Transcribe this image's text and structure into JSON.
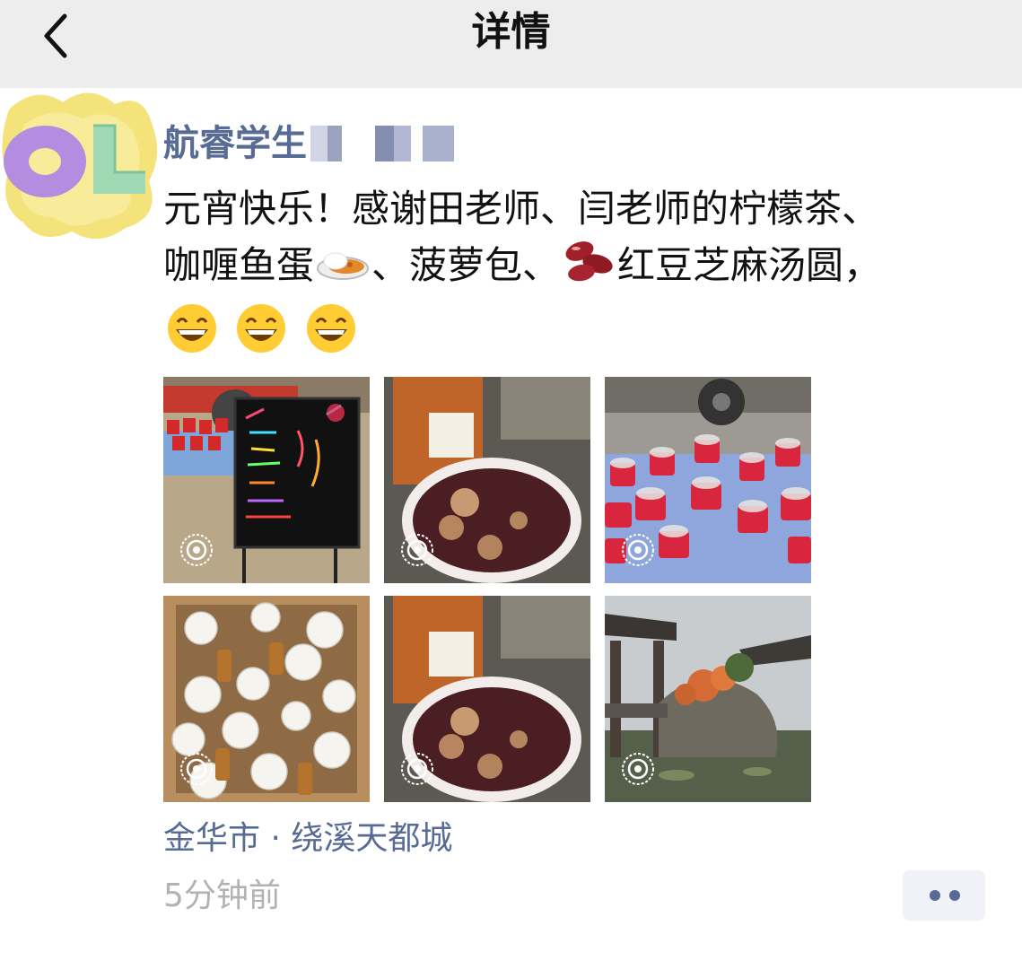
{
  "nav": {
    "title": "详情",
    "back_icon": "chevron-left-icon"
  },
  "post": {
    "author": "航睿学生",
    "content_line1": "元宵快乐！感谢田老师、闫老师的柠檬茶、",
    "content_line2_a": "咖喱鱼蛋",
    "content_line2_b": "、菠萝包、",
    "content_line2_c": "红豆芝麻汤圆，",
    "emoji_icons": [
      "curry-rice-emoji",
      "beans-emoji",
      "grinning-face-emoji"
    ],
    "photos": [
      {
        "name": "photo-lantern-sign",
        "live": true
      },
      {
        "name": "photo-tangyuan-bowl",
        "live": true
      },
      {
        "name": "photo-drink-cups-table",
        "live": true
      },
      {
        "name": "photo-tea-box",
        "live": true
      },
      {
        "name": "photo-tangyuan-bowl-2",
        "live": true
      },
      {
        "name": "photo-garden-pavilion",
        "live": true
      }
    ],
    "location": "金华市 · 绕溪天都城",
    "time": "5分钟前"
  },
  "colors": {
    "link": "#576b95",
    "nav_bg": "#ededed",
    "muted": "#b2b2b2"
  }
}
